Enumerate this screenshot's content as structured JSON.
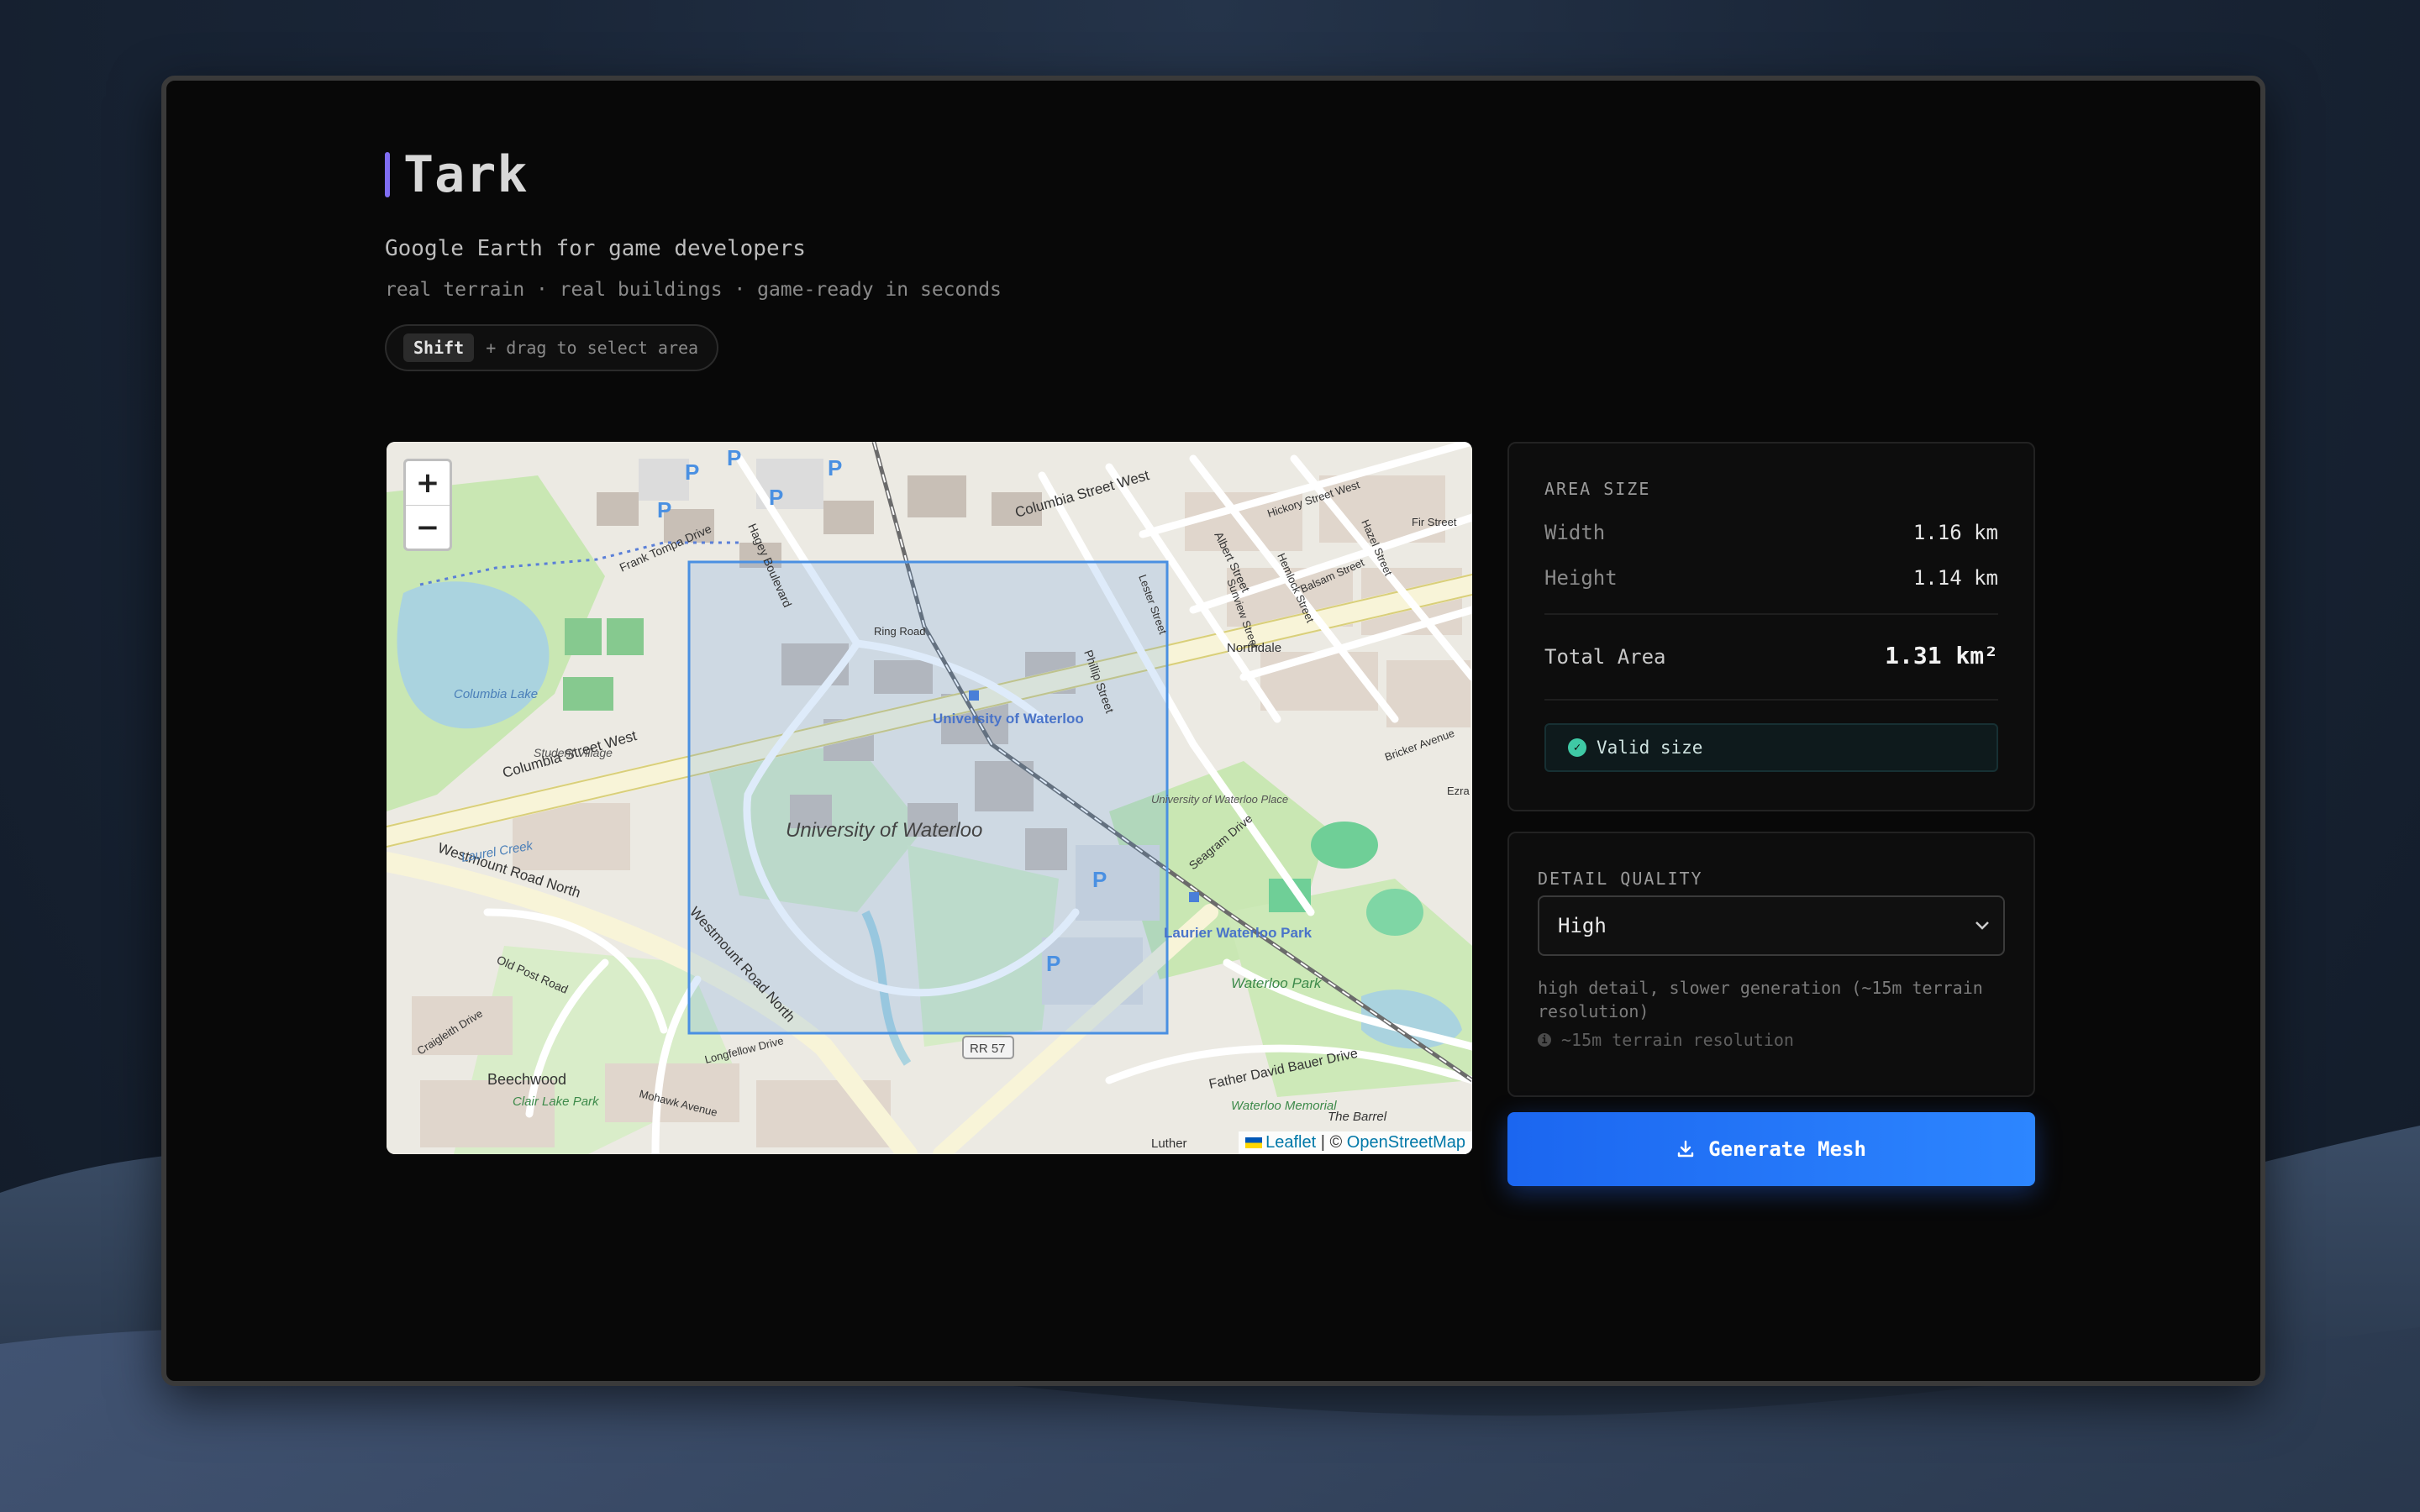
{
  "app": {
    "title": "Tark",
    "subtitle": "Google Earth for game developers",
    "tagline": "real terrain · real buildings · game-ready in seconds",
    "hint_key": "Shift",
    "hint_text": "+ drag to select area"
  },
  "map": {
    "zoom_in": "+",
    "zoom_out": "−",
    "labels": {
      "columbia_street_west_1": "Columbia Street West",
      "columbia_street_west_2": "Columbia Street West",
      "westmount_road_north_1": "Westmount Road North",
      "westmount_road_north_2": "Westmount Road North",
      "university_of_waterloo": "University of Waterloo",
      "uw_station": "University of Waterloo",
      "laurier_waterloo_park": "Laurier Waterloo Park",
      "waterloo_park": "Waterloo Park",
      "beechwood": "Beechwood",
      "northdale": "Northdale",
      "columbia_lake": "Columbia Lake",
      "ring_road": "Ring Road",
      "hagey_boulevard": "Hagey Boulevard",
      "frank_tompa_drive": "Frank Tompa Drive",
      "phillip_street": "Phillip Street",
      "lester_street": "Lester Street",
      "albert_street": "Albert Street",
      "seagram_drive": "Seagram Drive",
      "father_david_bauer": "Father David Bauer Drive",
      "old_post_road": "Old Post Road",
      "rr57": "RR 57",
      "student_village": "Student Village",
      "university_of_waterloo_place": "University of Waterloo Place",
      "laurel_creek": "Laurel Creek",
      "clair_lake_park": "Clair Lake Park",
      "the_barrel": "The Barrel",
      "waterloo_memorial": "Waterloo Memorial",
      "sunview_street": "Sunview Street",
      "hickory_street_west": "Hickory Street West",
      "fir_street": "Fir Street",
      "balsam_street": "Balsam Street",
      "hemlock_street": "Hemlock Street",
      "hazel_street": "Hazel Street",
      "bricker_avenue": "Bricker Avenue",
      "longfellow_drive": "Longfellow Drive",
      "mohawk_avenue": "Mohawk Avenue",
      "craigleith_drive": "Craigleith Drive",
      "luther": "Luther",
      "ezra": "Ezra",
      "parking": "P"
    },
    "attribution_leaflet": "Leaflet",
    "attribution_sep": " | © ",
    "attribution_osm": "OpenStreetMap"
  },
  "area": {
    "heading": "AREA SIZE",
    "width_label": "Width",
    "width_value": "1.16 km",
    "height_label": "Height",
    "height_value": "1.14 km",
    "total_label": "Total Area",
    "total_value": "1.31 km²",
    "status": "Valid size"
  },
  "quality": {
    "heading": "DETAIL QUALITY",
    "selected": "High",
    "description": "high detail, slower generation (~15m terrain resolution)",
    "info": "~15m terrain resolution"
  },
  "actions": {
    "generate": "Generate Mesh"
  },
  "colors": {
    "accent": "#7f6df2",
    "primary_button": "#2d86ff",
    "valid": "#3fc9a5",
    "selection": "#4a90e2"
  }
}
